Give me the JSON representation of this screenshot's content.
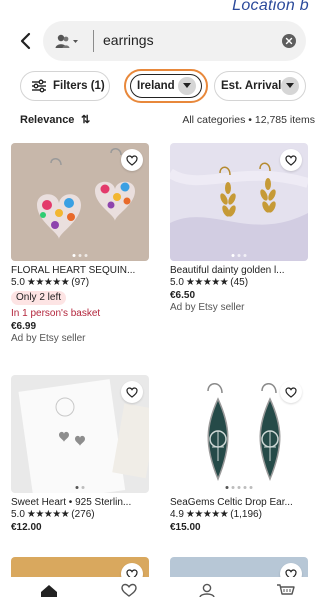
{
  "header_note": "Location b",
  "search": {
    "query": "earrings"
  },
  "filters": {
    "filters_label": "Filters (1)",
    "location_label": "Ireland",
    "arrival_label": "Est. Arrival"
  },
  "sort": {
    "label": "Relevance",
    "icon": "⇅",
    "categories_text": "All categories • 12,785 items"
  },
  "listings": [
    {
      "title": "FLORAL HEART SEQUIN...",
      "rating": "5.0",
      "stars": "★★★★★",
      "reviews": "(97)",
      "badge": "Only 2 left",
      "basket": "In 1 person's basket",
      "price": "€6.99",
      "ad": "Ad by Etsy seller"
    },
    {
      "title": "Beautiful dainty golden l...",
      "rating": "5.0",
      "stars": "★★★★★",
      "reviews": "(45)",
      "price": "€6.50",
      "ad": "Ad by Etsy seller"
    },
    {
      "title": "Sweet Heart • 925 Sterlin...",
      "rating": "5.0",
      "stars": "★★★★★",
      "reviews": "(276)",
      "price": "€12.00"
    },
    {
      "title": "SeaGems Celtic Drop Ear...",
      "rating": "4.9",
      "stars": "★★★★★",
      "reviews": "(1,196)",
      "price": "€15.00"
    }
  ],
  "colors": {
    "highlight_ring": "#e8883b",
    "basket_text": "#b3263c",
    "badge_bg": "#fde4e4"
  },
  "icons": [
    "back-arrow-icon",
    "user-scope-icon",
    "clear-icon",
    "filter-sliders-icon",
    "caret-down-icon",
    "heart-icon",
    "home-icon",
    "favorites-icon",
    "profile-icon",
    "cart-icon"
  ]
}
